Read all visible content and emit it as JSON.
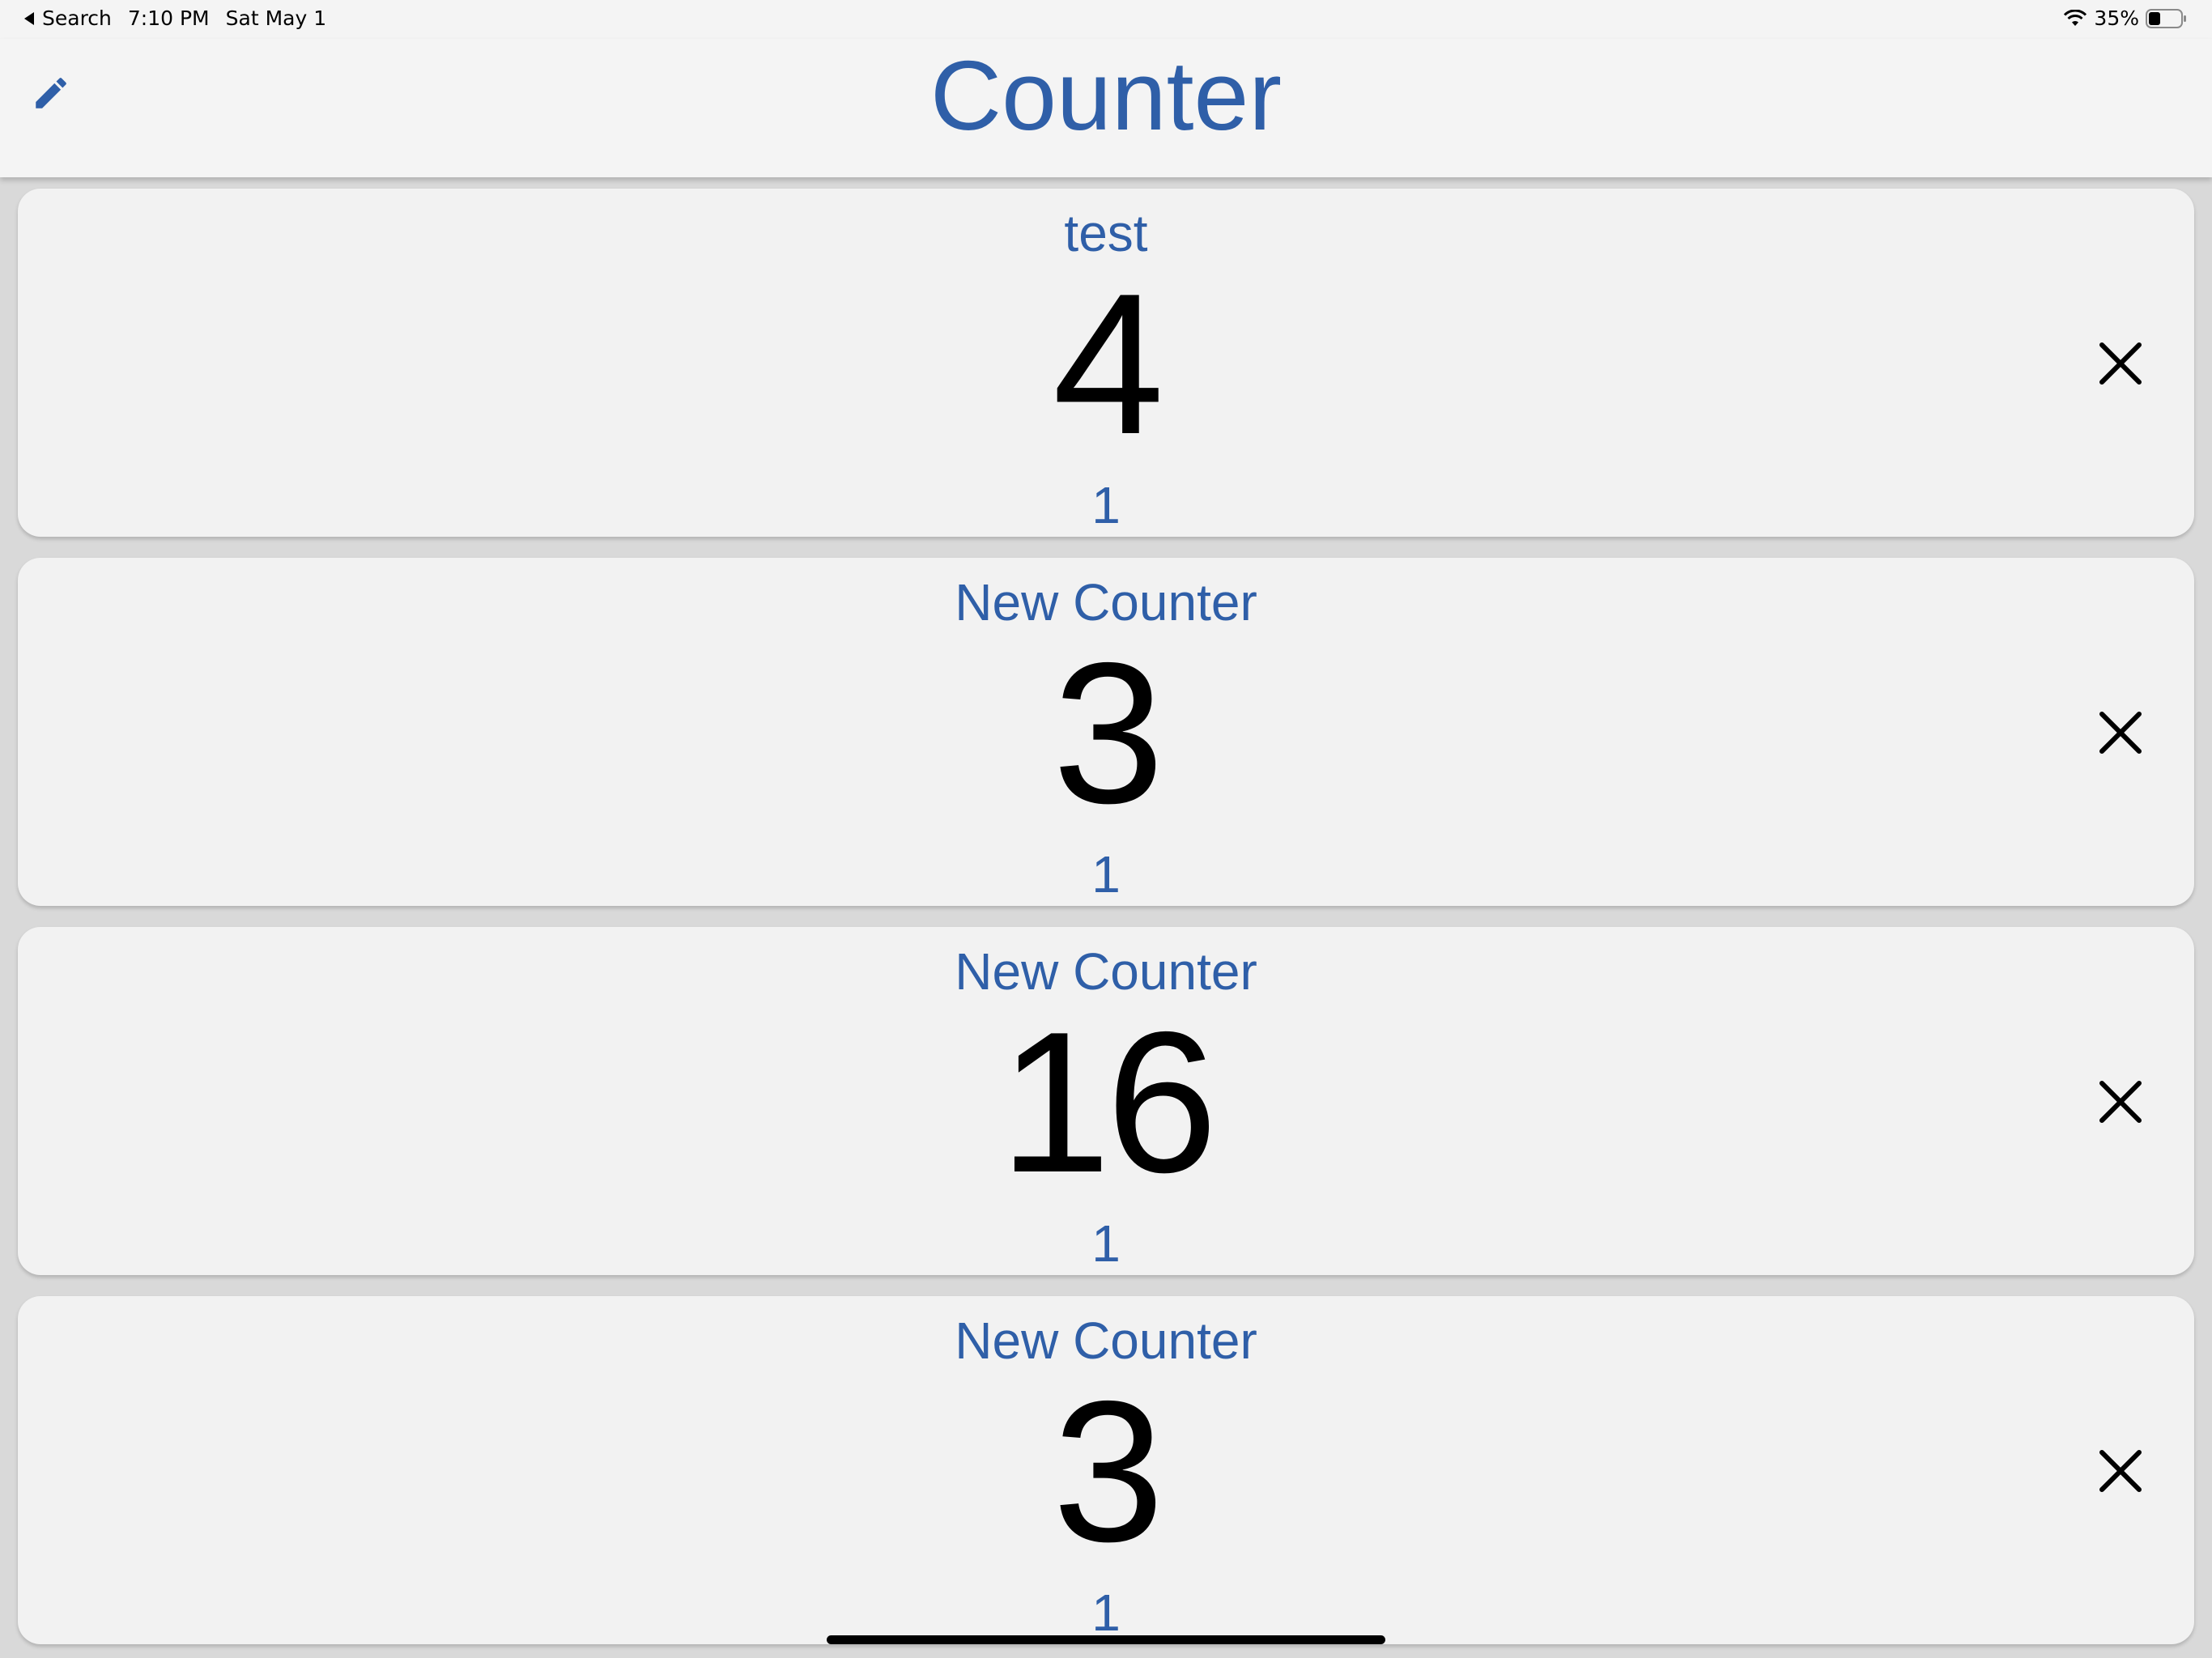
{
  "status_bar": {
    "back_label": "Search",
    "time": "7:10 PM",
    "date": "Sat May 1",
    "battery_percent": "35%",
    "battery_level": 0.35
  },
  "nav": {
    "title": "Counter",
    "edit_icon": "pencil-icon",
    "accent_color": "#2f5fa8"
  },
  "counters": [
    {
      "name": "test",
      "count": "4",
      "step": "1"
    },
    {
      "name": "New Counter",
      "count": "3",
      "step": "1"
    },
    {
      "name": "New Counter",
      "count": "16",
      "step": "1"
    },
    {
      "name": "New Counter",
      "count": "3",
      "step": "1"
    }
  ],
  "delete_icon": "close-icon"
}
